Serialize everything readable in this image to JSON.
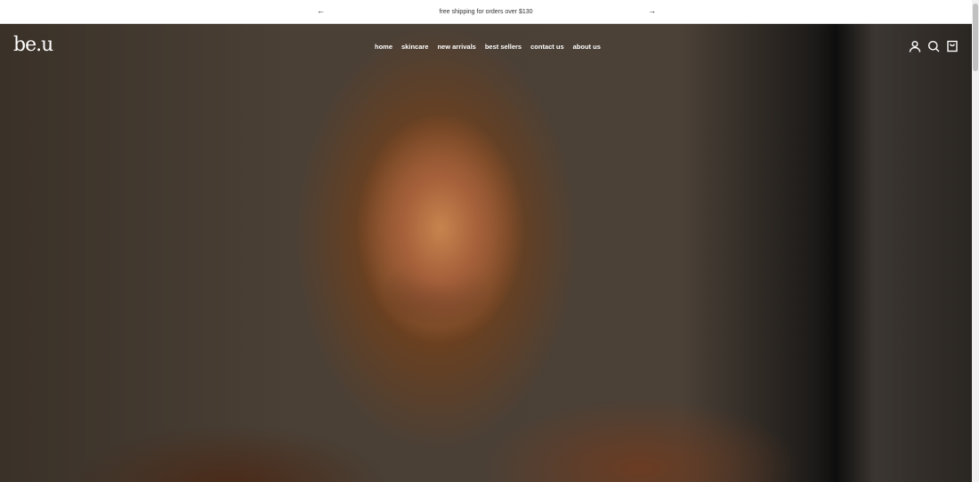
{
  "announcement": {
    "text": "free shipping for orders over $130",
    "prev": "←",
    "next": "→"
  },
  "header": {
    "logo": "be.u",
    "nav": [
      "home",
      "skincare",
      "new arrivals",
      "best sellers",
      "contact us",
      "about us"
    ]
  },
  "icons": [
    "account-icon",
    "search-icon",
    "cart-icon"
  ]
}
